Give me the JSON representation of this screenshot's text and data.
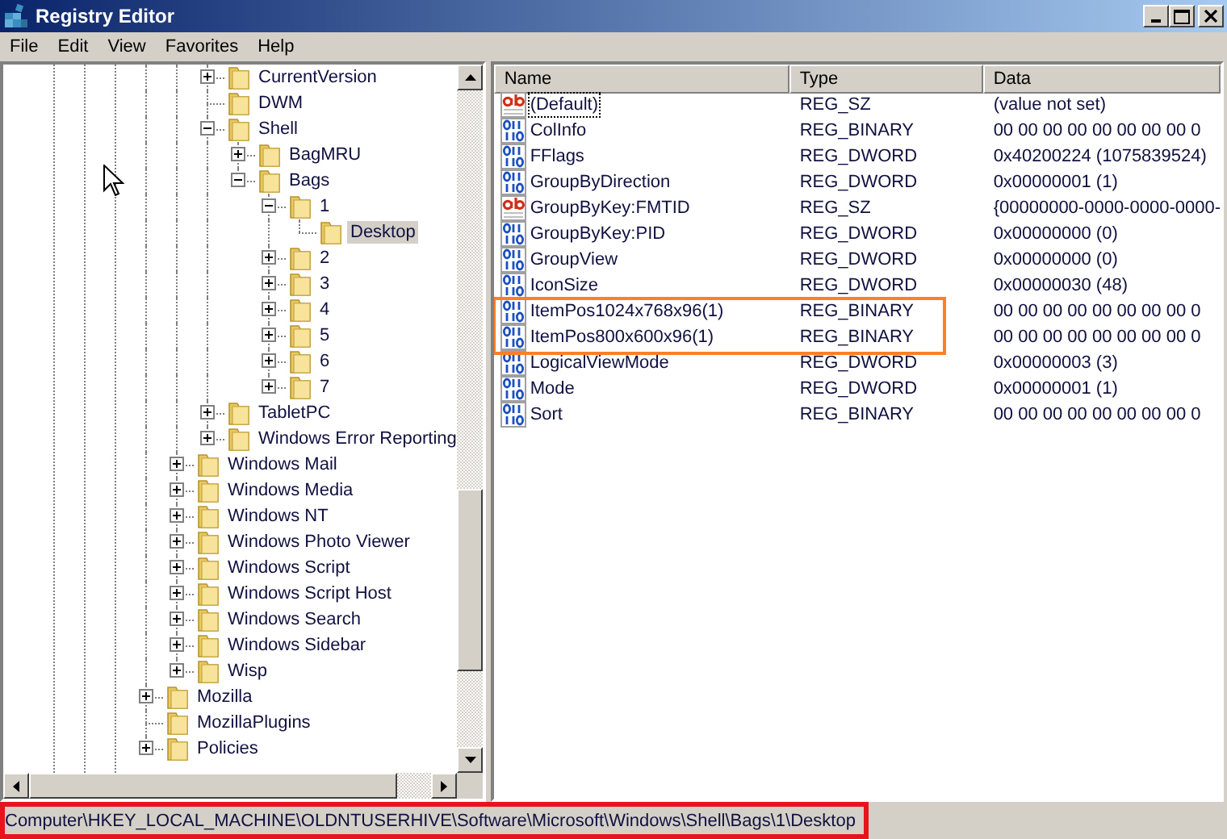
{
  "window": {
    "title": "Registry Editor"
  },
  "menu": [
    "File",
    "Edit",
    "View",
    "Favorites",
    "Help"
  ],
  "tree": [
    {
      "children": [
        {
          "children": [
            {
              "label": "CurrentVersion",
              "expanded": false,
              "selected": false
            },
            {
              "label": "DWM",
              "selected": false
            },
            {
              "label": "Shell",
              "expanded": true,
              "selected": false,
              "children": [
                {
                  "label": "BagMRU",
                  "expanded": false,
                  "selected": false
                },
                {
                  "label": "Bags",
                  "expanded": true,
                  "selected": false,
                  "children": [
                    {
                      "label": "1",
                      "expanded": true,
                      "selected": false,
                      "children": [
                        {
                          "label": "Desktop",
                          "selected": true
                        }
                      ]
                    },
                    {
                      "label": "2",
                      "expanded": false,
                      "selected": false
                    },
                    {
                      "label": "3",
                      "expanded": false,
                      "selected": false
                    },
                    {
                      "label": "4",
                      "expanded": false,
                      "selected": false
                    },
                    {
                      "label": "5",
                      "expanded": false,
                      "selected": false
                    },
                    {
                      "label": "6",
                      "expanded": false,
                      "selected": false
                    },
                    {
                      "label": "7",
                      "expanded": false,
                      "selected": false
                    }
                  ]
                }
              ]
            },
            {
              "label": "TabletPC",
              "expanded": false,
              "selected": false
            },
            {
              "label": "Windows Error Reporting",
              "expanded": false,
              "selected": false
            }
          ]
        },
        {
          "label": "Windows Mail",
          "expanded": false,
          "selected": false
        },
        {
          "label": "Windows Media",
          "expanded": false,
          "selected": false
        },
        {
          "label": "Windows NT",
          "expanded": false,
          "selected": false
        },
        {
          "label": "Windows Photo Viewer",
          "expanded": false,
          "selected": false
        },
        {
          "label": "Windows Script",
          "expanded": false,
          "selected": false
        },
        {
          "label": "Windows Script Host",
          "expanded": false,
          "selected": false
        },
        {
          "label": "Windows Search",
          "expanded": false,
          "selected": false
        },
        {
          "label": "Windows Sidebar",
          "expanded": false,
          "selected": false
        },
        {
          "label": "Wisp",
          "expanded": false,
          "selected": false
        }
      ]
    },
    {
      "label": "Mozilla",
      "expanded": false,
      "selected": false
    },
    {
      "label": "MozillaPlugins",
      "selected": false
    },
    {
      "label": "Policies",
      "expanded": false,
      "selected": false
    }
  ],
  "values": {
    "columns": [
      "Name",
      "Type",
      "Data"
    ],
    "rows": [
      {
        "kind": "string",
        "name": "(Default)",
        "type": "REG_SZ",
        "data": "(value not set)",
        "focused": true,
        "highlighted": false
      },
      {
        "kind": "binary",
        "name": "ColInfo",
        "type": "REG_BINARY",
        "data": "00 00 00 00 00 00 00 00 0",
        "focused": false,
        "highlighted": false
      },
      {
        "kind": "binary",
        "name": "FFlags",
        "type": "REG_DWORD",
        "data": "0x40200224 (1075839524)",
        "focused": false,
        "highlighted": false
      },
      {
        "kind": "binary",
        "name": "GroupByDirection",
        "type": "REG_DWORD",
        "data": "0x00000001 (1)",
        "focused": false,
        "highlighted": false
      },
      {
        "kind": "string",
        "name": "GroupByKey:FMTID",
        "type": "REG_SZ",
        "data": "{00000000-0000-0000-0000-",
        "focused": false,
        "highlighted": false
      },
      {
        "kind": "binary",
        "name": "GroupByKey:PID",
        "type": "REG_DWORD",
        "data": "0x00000000 (0)",
        "focused": false,
        "highlighted": false
      },
      {
        "kind": "binary",
        "name": "GroupView",
        "type": "REG_DWORD",
        "data": "0x00000000 (0)",
        "focused": false,
        "highlighted": false
      },
      {
        "kind": "binary",
        "name": "IconSize",
        "type": "REG_DWORD",
        "data": "0x00000030 (48)",
        "focused": false,
        "highlighted": false
      },
      {
        "kind": "binary",
        "name": "ItemPos1024x768x96(1)",
        "type": "REG_BINARY",
        "data": "00 00 00 00 00 00 00 00 0",
        "focused": false,
        "highlighted": true
      },
      {
        "kind": "binary",
        "name": "ItemPos800x600x96(1)",
        "type": "REG_BINARY",
        "data": "00 00 00 00 00 00 00 00 0",
        "focused": false,
        "highlighted": true
      },
      {
        "kind": "binary",
        "name": "LogicalViewMode",
        "type": "REG_DWORD",
        "data": "0x00000003 (3)",
        "focused": false,
        "highlighted": false
      },
      {
        "kind": "binary",
        "name": "Mode",
        "type": "REG_DWORD",
        "data": "0x00000001 (1)",
        "focused": false,
        "highlighted": false
      },
      {
        "kind": "binary",
        "name": "Sort",
        "type": "REG_BINARY",
        "data": "00 00 00 00 00 00 00 00 0",
        "focused": false,
        "highlighted": false
      }
    ]
  },
  "status_bar": {
    "text": "Computer\\HKEY_LOCAL_MACHINE\\OLDNTUSERHIVE\\Software\\Microsoft\\Windows\\Shell\\Bags\\1\\Desktop",
    "highlighted": true
  }
}
